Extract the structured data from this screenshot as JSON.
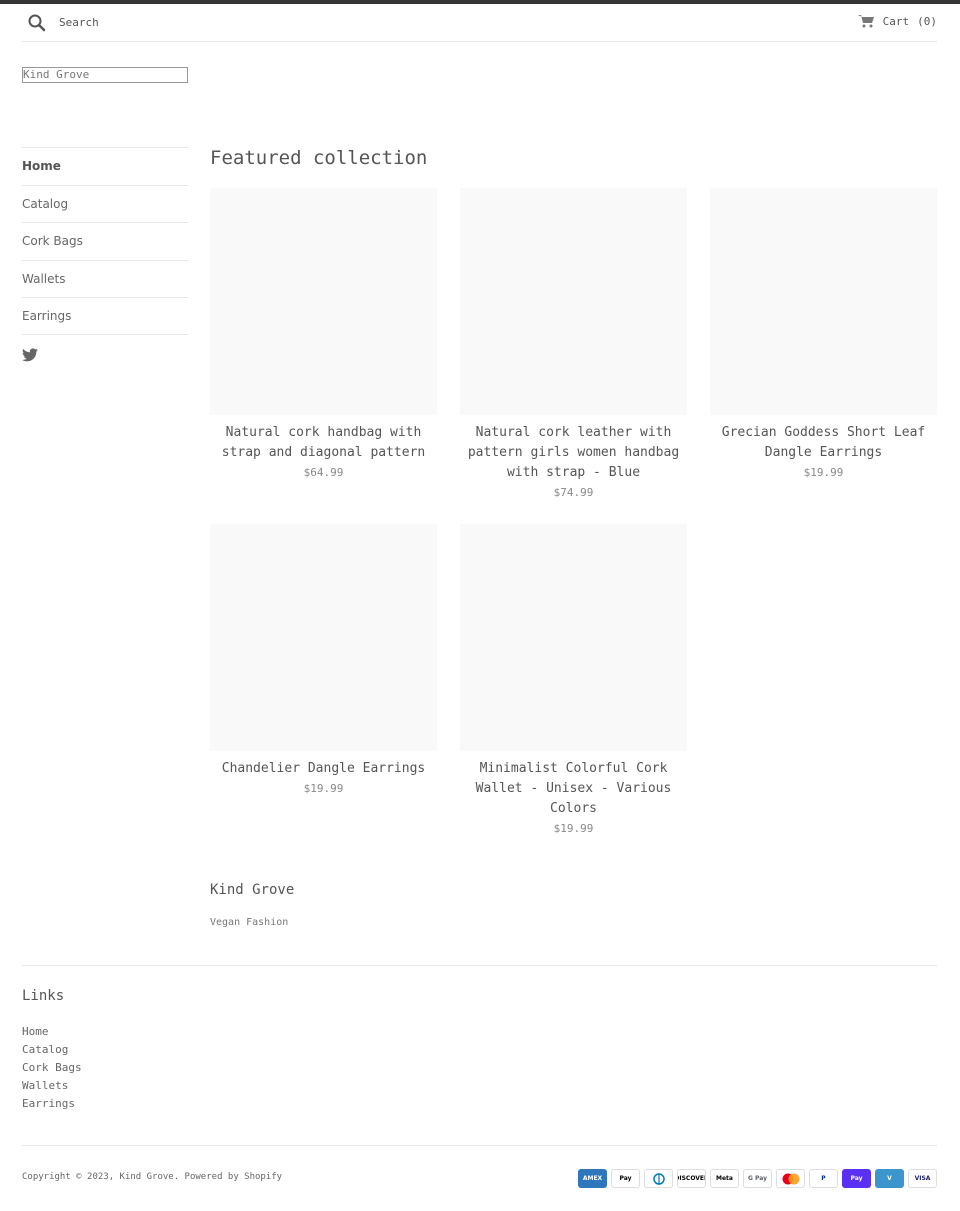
{
  "header": {
    "search_placeholder": "Search",
    "cart_label": "Cart",
    "cart_count": "(0)"
  },
  "logo_text": "Kind Grove",
  "sidebar": {
    "items": [
      {
        "label": "Home",
        "active": true
      },
      {
        "label": "Catalog"
      },
      {
        "label": "Cork Bags"
      },
      {
        "label": "Wallets"
      },
      {
        "label": "Earrings"
      }
    ]
  },
  "main": {
    "title": "Featured collection",
    "products": [
      {
        "title": "Natural cork handbag with strap and diagonal pattern",
        "price": "$64.99"
      },
      {
        "title": "Natural cork leather with pattern girls women handbag with strap - Blue",
        "price": "$74.99"
      },
      {
        "title": "Grecian Goddess Short Leaf Dangle Earrings",
        "price": "$19.99"
      },
      {
        "title": "Chandelier Dangle Earrings",
        "price": "$19.99"
      },
      {
        "title": "Minimalist Colorful Cork Wallet - Unisex - Various Colors",
        "price": "$19.99"
      }
    ]
  },
  "about": {
    "title": "Kind Grove",
    "text": "Vegan Fashion"
  },
  "footer": {
    "links_title": "Links",
    "links": [
      "Home",
      "Catalog",
      "Cork Bags",
      "Wallets",
      "Earrings"
    ],
    "copyright": "Copyright © 2023, Kind Grove. Powered by Shopify",
    "payments": [
      {
        "name": "amex-icon",
        "label": "AMEX",
        "bg": "#2e77bc",
        "fg": "#ffffff"
      },
      {
        "name": "apple-pay-icon",
        "label": "Pay",
        "bg": "#ffffff",
        "fg": "#000000"
      },
      {
        "name": "diners-club-icon",
        "label": "",
        "bg": "#ffffff",
        "fg": "#0079be"
      },
      {
        "name": "discover-icon",
        "label": "DISCOVER",
        "bg": "#ffffff",
        "fg": "#000000"
      },
      {
        "name": "meta-pay-icon",
        "label": "Meta",
        "bg": "#ffffff",
        "fg": "#000000"
      },
      {
        "name": "google-pay-icon",
        "label": "G Pay",
        "bg": "#ffffff",
        "fg": "#5f6368"
      },
      {
        "name": "mastercard-icon",
        "label": "",
        "bg": "#ffffff",
        "fg": "#000000"
      },
      {
        "name": "paypal-icon",
        "label": "P",
        "bg": "#ffffff",
        "fg": "#003087"
      },
      {
        "name": "shop-pay-icon",
        "label": "Pay",
        "bg": "#5a31f4",
        "fg": "#ffffff"
      },
      {
        "name": "venmo-icon",
        "label": "V",
        "bg": "#3d95ce",
        "fg": "#ffffff"
      },
      {
        "name": "visa-icon",
        "label": "VISA",
        "bg": "#ffffff",
        "fg": "#1a1f71"
      }
    ]
  },
  "colors": {
    "topbar": "#333333",
    "text": "#555555",
    "image_placeholder": "#f9f9f9"
  }
}
